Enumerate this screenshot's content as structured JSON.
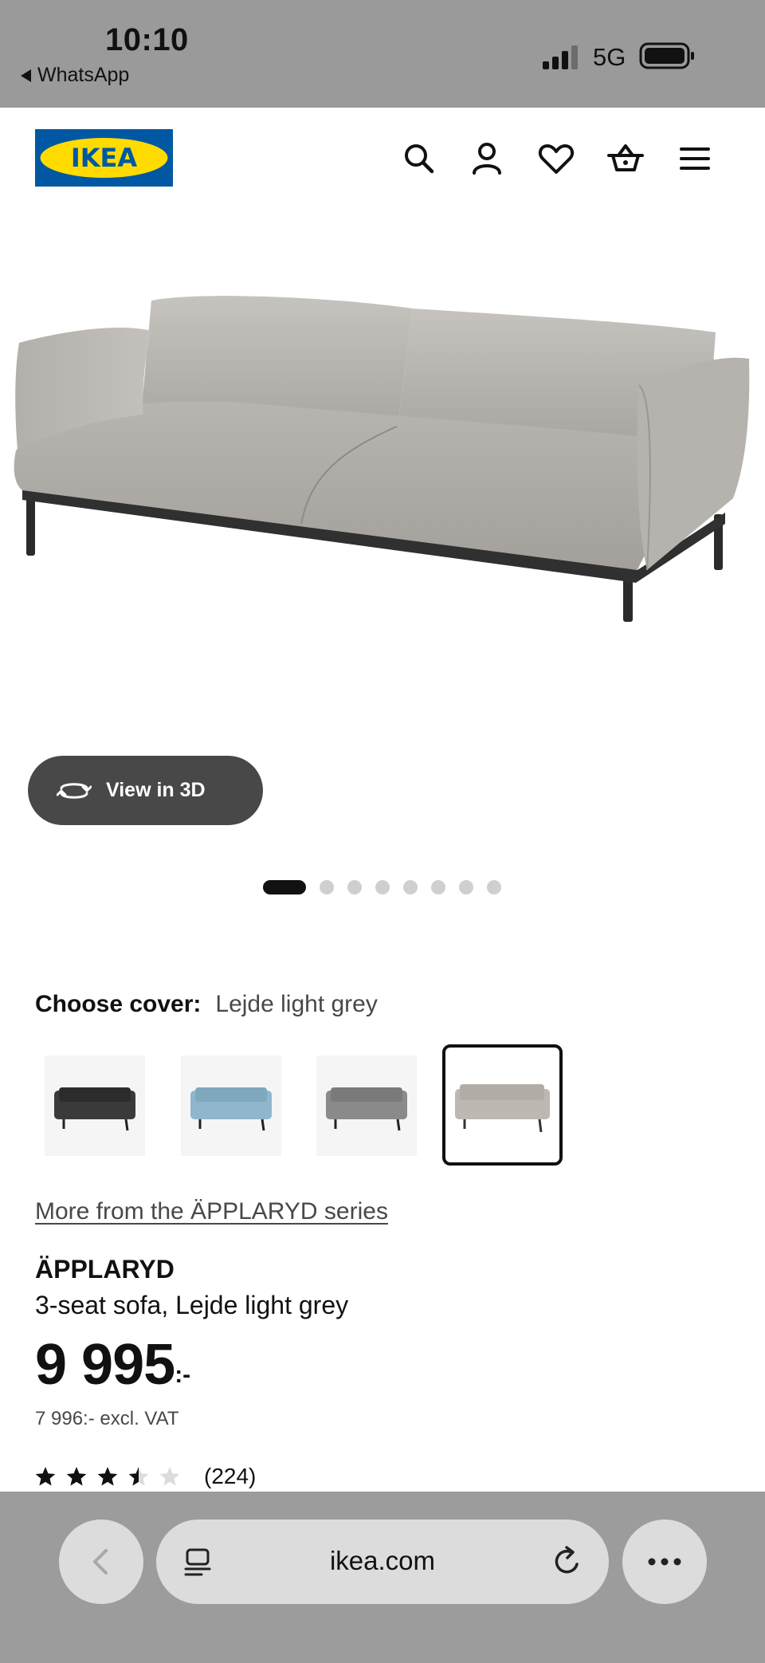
{
  "status_bar": {
    "time": "10:10",
    "back_app": "WhatsApp",
    "network": "5G",
    "signal_icon": "signal-bars-icon",
    "battery_icon": "battery-icon"
  },
  "header": {
    "logo_text": "IKEA",
    "brand_colors": {
      "blue": "#0058a3",
      "yellow": "#ffdb00"
    },
    "icons": [
      "search-icon",
      "account-icon",
      "heart-icon",
      "basket-icon",
      "menu-icon"
    ]
  },
  "gallery": {
    "view_3d_label": "View in 3D",
    "view_3d_icon": "rotate-3d-icon",
    "slide_count": 8,
    "active_slide": 1
  },
  "cover": {
    "label": "Choose cover:",
    "value": "Lejde light grey",
    "options": [
      {
        "name": "dark grey",
        "color": "#3a3a3a",
        "selected": false
      },
      {
        "name": "light blue",
        "color": "#8fb6cc",
        "selected": false
      },
      {
        "name": "grey",
        "color": "#8a8a8a",
        "selected": false
      },
      {
        "name": "Lejde light grey",
        "color": "#bdb8b1",
        "selected": true
      }
    ]
  },
  "product": {
    "series_link": "More from the ÄPPLARYD series",
    "name": "ÄPPLARYD",
    "description": "3-seat sofa, Lejde light grey",
    "price": "9 995",
    "price_suffix": ":-",
    "price_excl_vat": "7 996:- excl. VAT",
    "rating": 3.5,
    "rating_max": 5,
    "review_count": "(224)"
  },
  "browser_bar": {
    "url": "ikea.com",
    "icons": [
      "back-arrow-icon",
      "tabs-icon",
      "reload-icon",
      "more-icon"
    ]
  }
}
